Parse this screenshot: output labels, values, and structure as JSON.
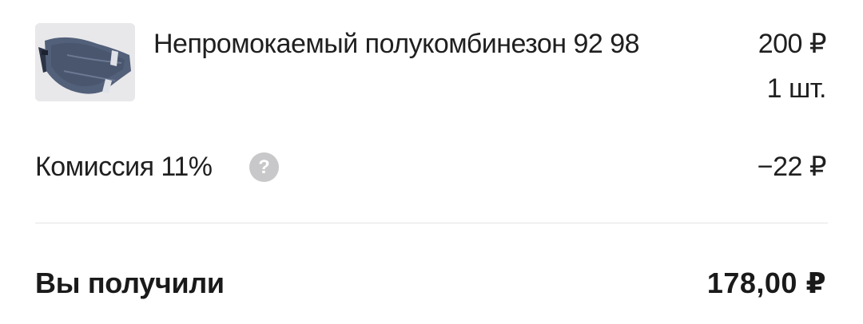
{
  "product": {
    "image_alt": "product-photo",
    "title": "Непромокаемый полукомбинезон 92 98",
    "price": "200 ₽",
    "quantity": "1 шт."
  },
  "fee": {
    "label": "Комиссия 11%",
    "help_icon": "?",
    "value": "−22 ₽"
  },
  "total": {
    "label": "Вы получили",
    "value": "178,00 ₽"
  }
}
